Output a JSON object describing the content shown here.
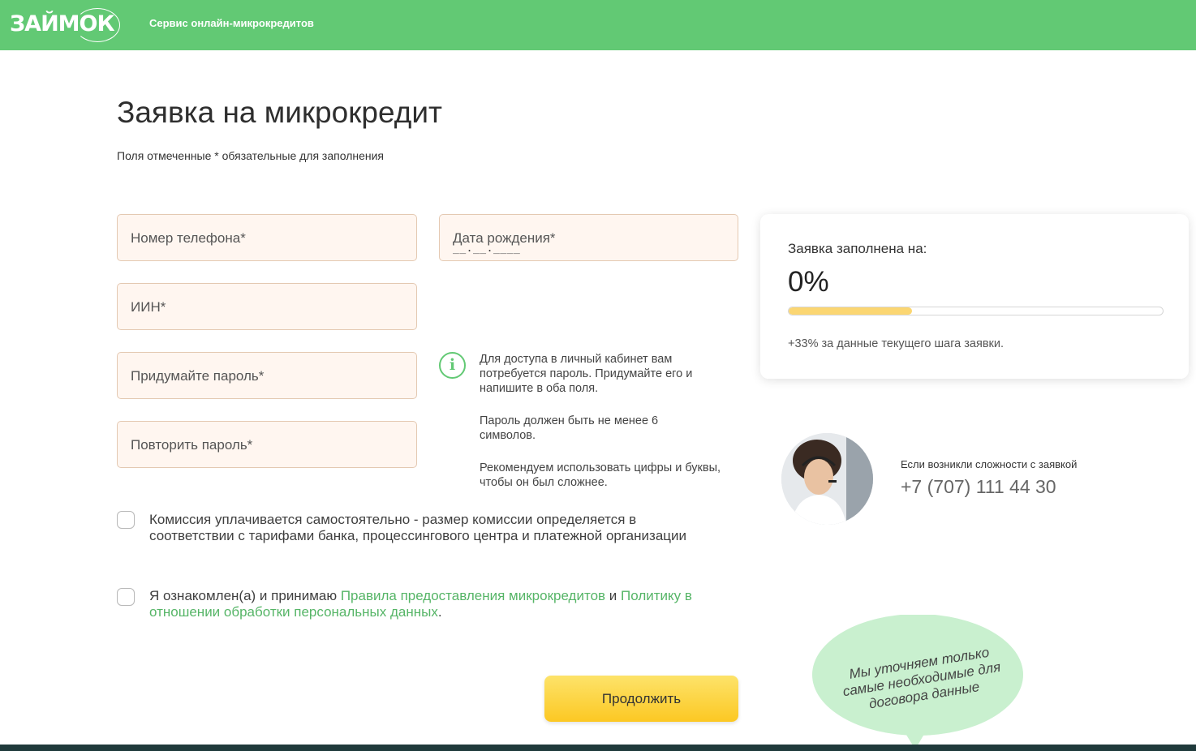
{
  "header": {
    "logo_text": "ЗАЙМОК",
    "tagline": "Сервис онлайн-микрокредитов",
    "bg_color": "#62c974"
  },
  "page": {
    "title": "Заявка на микрокредит",
    "subtitle": "Поля отмеченные * обязательные для заполнения"
  },
  "form": {
    "phone_placeholder": "Номер телефона*",
    "birth_placeholder": "Дата рождения*",
    "birth_mask": "__.__.____",
    "iin_placeholder": "ИИН*",
    "password_placeholder": "Придумайте пароль*",
    "password_repeat_placeholder": "Повторить пароль*"
  },
  "hints": {
    "icon": "info-icon",
    "hint1": "Для доступа в личный кабинет вам потребуется пароль. Придумайте его и напишите в оба поля.",
    "hint2": "Пароль должен быть не менее 6 символов.",
    "hint3": "Рекомендуем использовать цифры и буквы, чтобы он был сложнее."
  },
  "checkboxes": {
    "commission": "Комиссия уплачивается самостоятельно - размер комиссии определяется в соответствии с тарифами банка, процессингового центра и платежной организации",
    "agree_prefix": "Я ознакомлен(а) и принимаю ",
    "agree_link1": "Правила предоставления микрокредитов",
    "agree_middle": " и ",
    "agree_link2": "Политику в отношении обработки персональных данных",
    "agree_suffix": "."
  },
  "button": {
    "continue": "Продолжить"
  },
  "progress_card": {
    "label": "Заявка заполнена на:",
    "percent_text": "0%",
    "bar_fill_fraction": 0.33,
    "note": "+33% за данные текущего шага заявки."
  },
  "support": {
    "text": "Если возникли сложности с заявкой",
    "phone": "+7 (707) 111 44 30"
  },
  "bubble": {
    "text": "Мы уточняем только самые необходимые для договора данные",
    "color": "#c9f0cf"
  },
  "colors": {
    "accent_green": "#62c974",
    "link_green": "#56b567",
    "button_yellow": "#fcc823",
    "progress_yellow": "#fbd672"
  }
}
